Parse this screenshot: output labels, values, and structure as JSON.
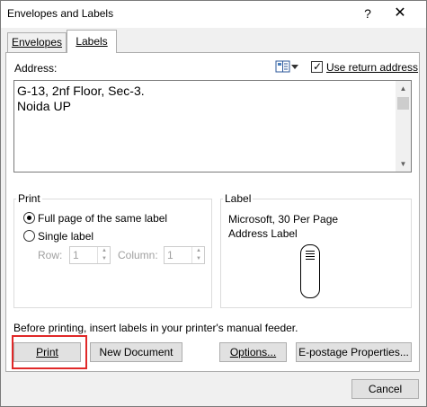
{
  "window": {
    "title": "Envelopes and Labels",
    "help_label": "?",
    "close_label": "✕"
  },
  "tabs": [
    {
      "label": "Envelopes",
      "selected": false
    },
    {
      "label": "Labels",
      "selected": true
    }
  ],
  "address": {
    "label": "Address:",
    "value": "G-13, 2nf Floor, Sec-3.\nNoida UP",
    "use_return_address_label": "Use return address",
    "use_return_address_checked": true
  },
  "print_group": {
    "legend": "Print",
    "full_page_label": "Full page of the same label",
    "single_label_label": "Single label",
    "selected": "full_page",
    "row_label": "Row:",
    "row_value": "1",
    "column_label": "Column:",
    "column_value": "1"
  },
  "label_group": {
    "legend": "Label",
    "product": "Microsoft, 30 Per Page",
    "type": "Address Label"
  },
  "note": "Before printing, insert labels in your printer's manual feeder.",
  "buttons": {
    "print": "Print",
    "new_document": "New Document",
    "options": "Options...",
    "epostage": "E-postage Properties...",
    "cancel": "Cancel"
  },
  "colors": {
    "highlight": "#e02828",
    "dialog_bg": "#f0f0f0",
    "button_bg": "#e1e1e1"
  }
}
